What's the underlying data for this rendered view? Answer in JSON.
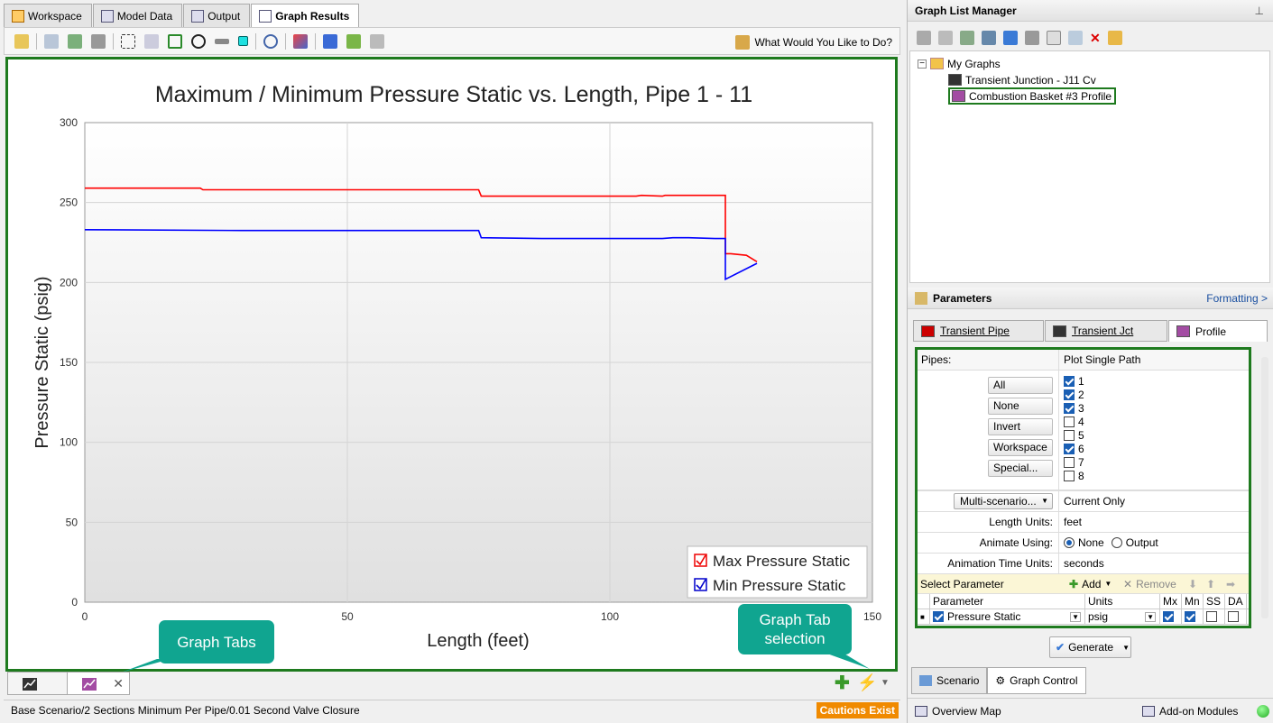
{
  "main_tabs": [
    {
      "label": "Workspace"
    },
    {
      "label": "Model Data"
    },
    {
      "label": "Output"
    },
    {
      "label": "Graph Results"
    }
  ],
  "toolbar": {
    "help_label": "What Would You Like to Do?"
  },
  "chart_data": {
    "type": "line",
    "title": "Maximum / Minimum Pressure Static vs. Length, Pipe 1 - 11",
    "xlabel": "Length (feet)",
    "ylabel": "Pressure Static (psig)",
    "xlim": [
      0,
      150
    ],
    "ylim": [
      0,
      300
    ],
    "x_ticks": [
      "0",
      "50",
      "100",
      "150"
    ],
    "y_ticks": [
      "0",
      "50",
      "100",
      "150",
      "200",
      "250",
      "300"
    ],
    "grid": true,
    "legend_position": "bottom-right",
    "series": [
      {
        "name": "Max Pressure Static",
        "color": "#ff0000",
        "x": [
          0,
          22,
          22.5,
          75,
          75.5,
          90,
          105,
          106,
          110,
          110.5,
          112,
          122,
          122,
          123,
          126,
          128
        ],
        "y": [
          259,
          259,
          258,
          258,
          254,
          254,
          254,
          254.5,
          254,
          254.5,
          254.5,
          254.5,
          218,
          218,
          217,
          213
        ]
      },
      {
        "name": "Min Pressure Static",
        "color": "#0000ff",
        "x": [
          0,
          30,
          75,
          75.5,
          87,
          110,
          112,
          115,
          120,
          122,
          122,
          128
        ],
        "y": [
          233,
          232.5,
          232.5,
          228,
          227.5,
          227.5,
          228,
          228,
          227.5,
          227.5,
          202,
          212
        ]
      }
    ]
  },
  "callouts": {
    "graph_tabs": "Graph Tabs",
    "graph_tab_selection_line1": "Graph Tab",
    "graph_tab_selection_line2": "selection"
  },
  "status": {
    "scenario_path": "Base Scenario/2 Sections Minimum Per Pipe/0.01 Second Valve Closure",
    "cautions": "Cautions Exist"
  },
  "glm": {
    "title": "Graph List Manager",
    "root": "My Graphs",
    "items": [
      "Transient Junction - J11 Cv",
      "Combustion Basket #3 Profile"
    ]
  },
  "params": {
    "title": "Parameters",
    "formatting": "Formatting >",
    "tabs": [
      "Transient Pipe",
      "Transient Jct",
      "Profile"
    ],
    "pipes_label": "Pipes:",
    "plot_mode": "Plot Single Path",
    "buttons": [
      "All",
      "None",
      "Invert",
      "Workspace",
      "Special..."
    ],
    "pipes": [
      {
        "id": "1",
        "checked": true
      },
      {
        "id": "2",
        "checked": true
      },
      {
        "id": "3",
        "checked": true
      },
      {
        "id": "4",
        "checked": false
      },
      {
        "id": "5",
        "checked": false
      },
      {
        "id": "6",
        "checked": true
      },
      {
        "id": "7",
        "checked": false
      },
      {
        "id": "8",
        "checked": false
      }
    ],
    "multi_scenario": "Multi-scenario...",
    "multi_value": "Current Only",
    "length_units_label": "Length Units:",
    "length_units": "feet",
    "animate_label": "Animate Using:",
    "animate_none": "None",
    "animate_output": "Output",
    "anim_time_label": "Animation Time Units:",
    "anim_time": "seconds",
    "select_param": "Select Parameter",
    "add": "Add",
    "remove": "Remove",
    "table_headers": {
      "parameter": "Parameter",
      "units": "Units",
      "mx": "Mx",
      "mn": "Mn",
      "ss": "SS",
      "da": "DA"
    },
    "row": {
      "parameter": "Pressure Static",
      "units": "psig"
    },
    "generate": "Generate"
  },
  "bottom_tabs": [
    "Scenario",
    "Graph Control"
  ],
  "bottom_bar": {
    "overview": "Overview Map",
    "addon": "Add-on Modules"
  }
}
